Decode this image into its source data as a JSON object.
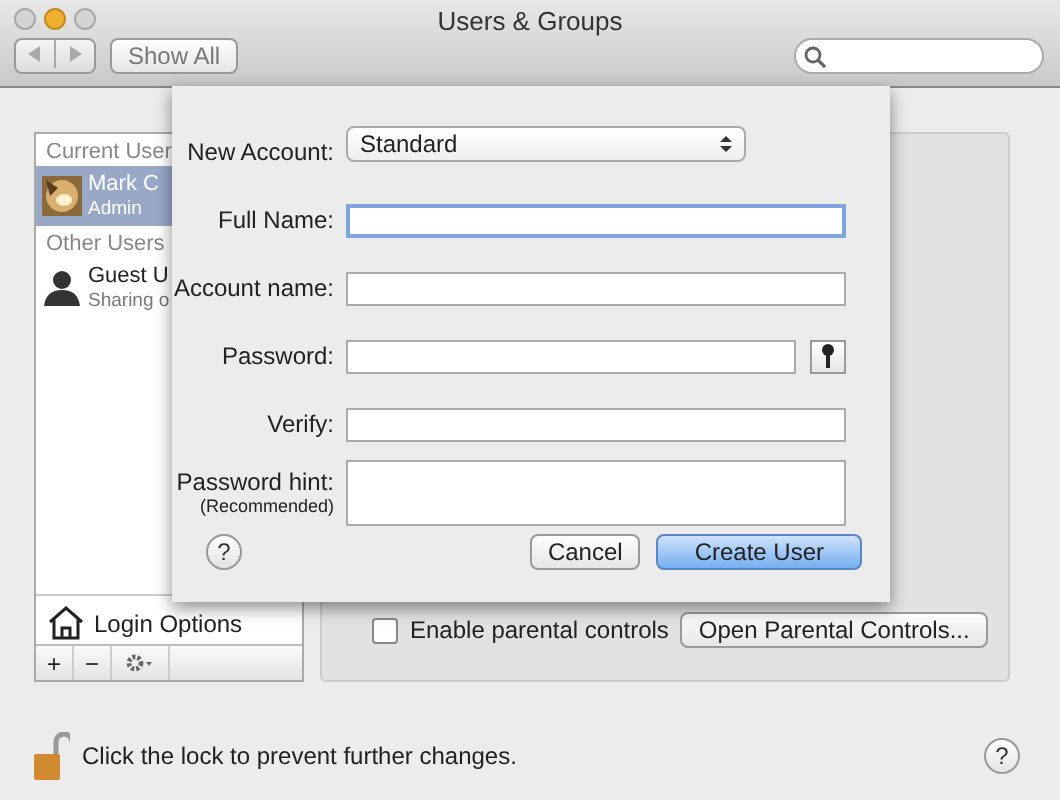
{
  "window": {
    "title": "Users & Groups"
  },
  "toolbar": {
    "show_all": "Show All"
  },
  "sidebar": {
    "sections": [
      {
        "header": "Current User",
        "users": [
          {
            "name": "Mark C",
            "role": "Admin",
            "selected": true
          }
        ]
      },
      {
        "header": "Other Users",
        "users": [
          {
            "name": "Guest U",
            "role": "Sharing o",
            "selected": false,
            "kind": "silhouette"
          }
        ]
      }
    ],
    "login_options": "Login Options",
    "add": "+",
    "remove": "−"
  },
  "parental": {
    "checked": false,
    "label": "Enable parental controls",
    "button": "Open Parental Controls..."
  },
  "lock_text": "Click the lock to prevent further changes.",
  "help": "?",
  "sheet": {
    "new_account_label": "New Account:",
    "new_account_value": "Standard",
    "fields": [
      {
        "label": "Full Name:",
        "kind": "text",
        "focused": true
      },
      {
        "label": "Account name:",
        "kind": "text",
        "focused": false
      },
      {
        "label": "Password:",
        "kind": "password",
        "focused": false
      },
      {
        "label": "Verify:",
        "kind": "text",
        "focused": false
      },
      {
        "label": "Password hint:",
        "sublabel": "(Recommended)",
        "kind": "area",
        "focused": false
      }
    ],
    "help": "?",
    "cancel": "Cancel",
    "create": "Create User"
  }
}
